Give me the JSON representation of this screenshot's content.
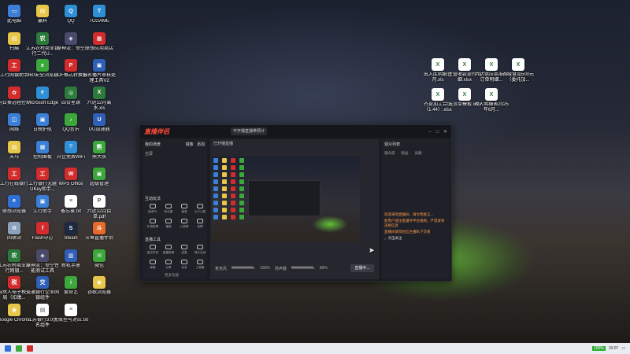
{
  "desktop_icons": [
    {
      "label": "此电脑",
      "color": "#3b7fd6",
      "glyph": "▭"
    },
    {
      "label": "扫描",
      "color": "#e8c64a",
      "glyph": "▤"
    },
    {
      "label": "工行网银助手",
      "color": "#d22c2c",
      "glyph": "工"
    },
    {
      "label": "向日葵远程控制",
      "color": "#d22c2c",
      "glyph": "✿"
    },
    {
      "label": "网络",
      "color": "#3b7fd6",
      "glyph": "◫"
    },
    {
      "label": "天马",
      "color": "#e8c64a",
      "glyph": "▤"
    },
    {
      "label": "工行在线银行",
      "color": "#d22c2c",
      "glyph": "工"
    },
    {
      "label": "联想浏览器",
      "color": "#2f6fd6",
      "glyph": "e"
    },
    {
      "label": "回收站",
      "color": "#8ba3bd",
      "glyph": "♻"
    },
    {
      "label": "江苏农村商业银行网银...",
      "color": "#2c7a3c",
      "glyph": "农"
    },
    {
      "label": "自然人电子税务局（扣缴...",
      "color": "#d22c2c",
      "glyph": "税"
    },
    {
      "label": "Google Chrome",
      "color": "#e8c64a",
      "glyph": "◉"
    },
    {
      "label": "赢科",
      "color": "#e8c64a",
      "glyph": "▤"
    },
    {
      "label": "江苏农村商业银行二代U...",
      "color": "#2c7a3c",
      "glyph": "农"
    },
    {
      "label": "360安全浏览器",
      "color": "#3ca83c",
      "glyph": "e"
    },
    {
      "label": "Microsoft Edge",
      "color": "#2f8fd6",
      "glyph": "e"
    },
    {
      "label": "日晚护航",
      "color": "#3b7fd6",
      "glyph": "▣"
    },
    {
      "label": "控制面板",
      "color": "#3b7fd6",
      "glyph": "▦"
    },
    {
      "label": "工行银行无疆UKey助手...",
      "color": "#d22c2c",
      "glyph": "工"
    },
    {
      "label": "江行助手",
      "color": "#3b7fd6",
      "glyph": "▣"
    },
    {
      "label": "Flash中心",
      "color": "#d22c2c",
      "glyph": "f"
    },
    {
      "label": "原神流：惊空性能测试工具",
      "color": "#4a4a6a",
      "glyph": "◈"
    },
    {
      "label": "交通银行企业网银组件",
      "color": "#2f5fb6",
      "glyph": "交"
    },
    {
      "label": "江苏银行3.0签名组件",
      "color": "#ffffff",
      "glyph": "▤"
    },
    {
      "label": "QQ",
      "color": "#2f8fd6",
      "glyph": "Q"
    },
    {
      "label": "原神流：惊空",
      "color": "#4a4a6a",
      "glyph": "◈"
    },
    {
      "label": "PDF格式转换器",
      "color": "#d22c2c",
      "glyph": "P"
    },
    {
      "label": "四合星球",
      "color": "#2c7a3c",
      "glyph": "◎"
    },
    {
      "label": "QQ音乐",
      "color": "#3ca83c",
      "glyph": "♪"
    },
    {
      "label": "开企免费WiFi",
      "color": "#2f8fd6",
      "glyph": "⌔"
    },
    {
      "label": "WPS Office",
      "color": "#d22c2c",
      "glyph": "W"
    },
    {
      "label": "备忘录.txt",
      "color": "#ffffff",
      "glyph": "≡"
    },
    {
      "label": "Steam",
      "color": "#1b2a40",
      "glyph": "S"
    },
    {
      "label": "新机手册",
      "color": "#2f5fb6",
      "glyph": "▥"
    },
    {
      "label": "爱奇艺",
      "color": "#3ca83c",
      "glyph": "i"
    },
    {
      "label": "大账型号对应.txt",
      "color": "#ffffff",
      "glyph": "≡"
    },
    {
      "label": "TCGAME",
      "color": "#2f8fd6",
      "glyph": "T"
    },
    {
      "label": "联想应用商店",
      "color": "#d22c2c",
      "glyph": "▦"
    },
    {
      "label": "报名播片审核处理工具V2",
      "color": "#2f5fb6",
      "glyph": "▣"
    },
    {
      "label": "六达12月离水.xls",
      "color": "#2c7a3c",
      "glyph": "X"
    },
    {
      "label": "UU加速器",
      "color": "#2f5fb6",
      "glyph": "U"
    },
    {
      "label": "熊大侠",
      "color": "#3ca83c",
      "glyph": "熊"
    },
    {
      "label": "超级管理",
      "color": "#3ca83c",
      "glyph": "▣"
    },
    {
      "label": "六达12月目单.pdf",
      "color": "#ffffff",
      "glyph": "P"
    },
    {
      "label": "斗鱼直播伴侣",
      "color": "#e86a2a",
      "glyph": "斗"
    },
    {
      "label": "微信",
      "color": "#3ca83c",
      "glyph": "✉"
    },
    {
      "label": "谷歌浏览器",
      "color": "#e8c64a",
      "glyph": "◉"
    }
  ],
  "right_files": [
    {
      "label": "出入库明细11月.xls"
    },
    {
      "label": "主管收款提付明细.xlsx"
    },
    {
      "label": "六达供应商准群订单明细..."
    },
    {
      "label": "齐缘食品500元（委托加..."
    },
    {
      "label": "齐提加工合同（1.44）.xlsx"
    },
    {
      "label": "送货单模板.xlsx"
    },
    {
      "label": "收入明细表2025年6月..."
    }
  ],
  "app": {
    "logo": "直播伴侣",
    "tab_label": "不开播直播带预计",
    "tab2_label": "",
    "left_mode": "我的场景",
    "left_btn1": "镜像",
    "left_btn2": "添加",
    "scene_label": "全屏",
    "section_interact": "互动玩法",
    "section_tools": "直播工具",
    "tools_interact": [
      "连线PK",
      "粉丝团",
      "抽奖",
      "七夕心愿"
    ],
    "tools_interact2": [
      "礼物投票",
      "福袋",
      "心愿榜",
      "投票"
    ],
    "tools_live": [
      "高光时刻",
      "直播剪辑",
      "连麦",
      "观众互动"
    ],
    "tools_live2": [
      "弹幕",
      "分享",
      "任务",
      "工具箱"
    ],
    "more_label": "更多功能",
    "preview_tab": "已开播直播",
    "volume1": "100%",
    "volume2": "80%",
    "mic_label": "麦克风",
    "speaker_label": "扬声器",
    "live_btn": "直播中...",
    "right_title": "观众列表",
    "right_tabs": [
      "观众席",
      "粉丝",
      "贡献"
    ],
    "chat_lines": [
      "欢迎来到直播间，请文明发言...",
      "新用户请注意遵守平台规则，严禁发布违规信息",
      "直播间请勿轻信主播私下交易",
      "，点击关注"
    ]
  },
  "taskbar": {
    "battery": "100%",
    "time": "10:07"
  }
}
